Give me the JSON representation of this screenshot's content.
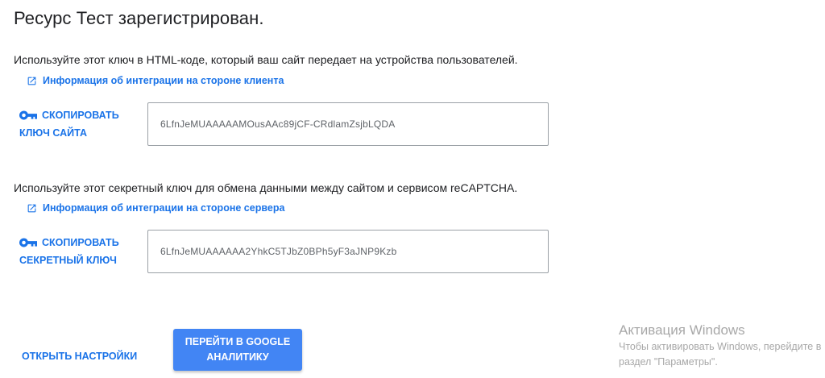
{
  "page": {
    "title": "Ресурс Тест зарегистрирован."
  },
  "site_key_section": {
    "description": "Используйте этот ключ в HTML-коде, который ваш сайт передает на устройства пользователей.",
    "doc_link": "Информация об интеграции на стороне клиента",
    "copy_button_line1": "СКОПИРОВАТЬ",
    "copy_button_line2": "КЛЮЧ САЙТА",
    "key_value": "6LfnJeMUAAAAAMOusAAc89jCF-CRdlamZsjbLQDA"
  },
  "secret_key_section": {
    "description": "Используйте этот секретный ключ для обмена данными между сайтом и сервисом reCAPTCHA.",
    "doc_link": "Информация об интеграции на стороне сервера",
    "copy_button_line1": "СКОПИРОВАТЬ",
    "copy_button_line2": "СЕКРЕТНЫЙ КЛЮЧ",
    "key_value": "6LfnJeMUAAAAAA2YhkC5TJbZ0BPh5yF3aJNP9Kzb"
  },
  "footer": {
    "settings_link": "ОТКРЫТЬ НАСТРОЙКИ",
    "analytics_button": "ПЕРЕЙТИ В GOOGLE АНАЛИТИКУ"
  },
  "windows_watermark": {
    "title": "Активация Windows",
    "line1": "Чтобы активировать Windows, перейдите в",
    "line2": "раздел \"Параметры\"."
  },
  "colors": {
    "link": "#1a73e8",
    "primary_button": "#4285f4",
    "text": "#202124",
    "key_text": "#5f6368"
  },
  "icons": {
    "doc_link": "open-in-new-icon",
    "copy": "key-icon"
  }
}
